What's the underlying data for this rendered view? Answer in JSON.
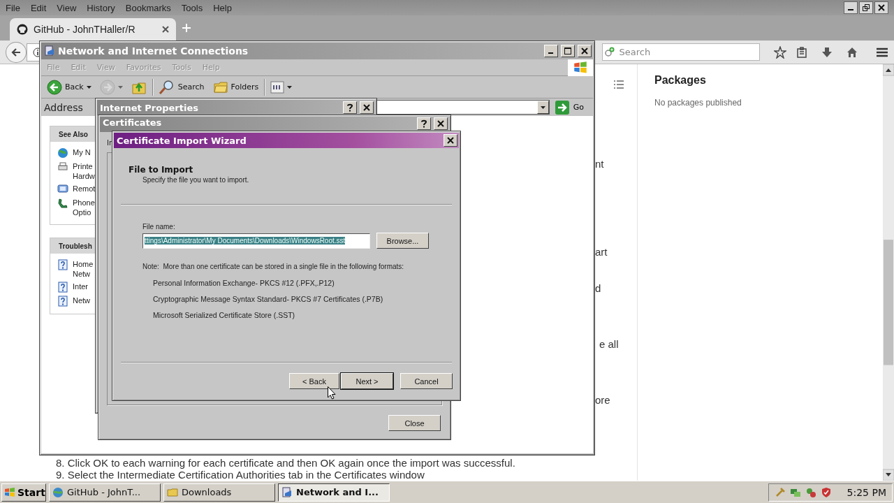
{
  "browser": {
    "menu": [
      "File",
      "Edit",
      "View",
      "History",
      "Bookmarks",
      "Tools",
      "Help"
    ],
    "tabs": [
      {
        "title": "GitHub - JohnTHaller/R",
        "selected": true
      }
    ],
    "search": {
      "placeholder": "Search"
    }
  },
  "page": {
    "fragments": [
      "nt",
      "art",
      "d",
      "e all",
      "ore"
    ],
    "steps": [
      "8. Click OK to each warning for each certificate and then OK again once the import was successful.",
      "9. Select the Intermediate Certification Authorities tab in the Certificates window"
    ],
    "sidebar": {
      "heading": "Packages",
      "text": "No packages published"
    }
  },
  "explorer": {
    "title": "Network and Internet Connections",
    "active": false,
    "menu": [
      {
        "label": "File",
        "disabled": true
      },
      {
        "label": "Edit",
        "disabled": true
      },
      {
        "label": "View",
        "disabled": true
      },
      {
        "label": "Favorites",
        "disabled": true
      },
      {
        "label": "Tools",
        "disabled": true
      },
      {
        "label": "Help",
        "disabled": true
      }
    ],
    "toolbar": [
      {
        "kind": "back",
        "label": "Back",
        "disabled": false
      },
      {
        "kind": "forward",
        "disabled": true
      },
      {
        "kind": "up",
        "disabled": false
      },
      {
        "kind": "search",
        "label": "Search",
        "disabled": false
      },
      {
        "kind": "folders",
        "label": "Folders",
        "disabled": false
      },
      {
        "kind": "views",
        "disabled": false
      }
    ],
    "address": {
      "label": "Address",
      "go": "Go"
    },
    "panes": [
      {
        "title": "See Also",
        "items": [
          {
            "kind": "network",
            "text": "My N"
          },
          {
            "kind": "printer",
            "text": "Printe\nHardw"
          },
          {
            "kind": "remote",
            "text": "Remot"
          },
          {
            "kind": "phone",
            "text": "Phone\nOptio"
          }
        ]
      },
      {
        "title": "Troublesh",
        "items": [
          {
            "kind": "help",
            "text": "Home\nNetw"
          },
          {
            "kind": "help",
            "text": "Inter"
          },
          {
            "kind": "help",
            "text": "Netw"
          }
        ]
      }
    ]
  },
  "internet_properties": {
    "title": "Internet Properties",
    "active": false
  },
  "certificates": {
    "title": "Certificates",
    "active": false,
    "label_fragment": "Ir",
    "close": "Close"
  },
  "wizard": {
    "title": "Certificate Import Wizard",
    "active": true,
    "heading": "File to Import",
    "subheading": "Specify the file you want to import.",
    "file_label": "File name:",
    "file_value": "ttings\\Administrator\\My Documents\\Downloads\\WindowsRoot.sst",
    "file_value_selected": true,
    "browse": "Browse...",
    "note": "Note:  More than one certificate can be stored in a single file in the following formats:",
    "formats": [
      "Personal Information Exchange- PKCS #12 (.PFX,.P12)",
      "Cryptographic Message Syntax Standard- PKCS #7 Certificates (.P7B)",
      "Microsoft Serialized Certificate Store (.SST)"
    ],
    "buttons": [
      {
        "label": "< Back",
        "default": false
      },
      {
        "label": "Next >",
        "default": true
      },
      {
        "label": "Cancel",
        "default": false
      }
    ]
  },
  "taskbar": {
    "start": "Start",
    "tasks": [
      {
        "label": "GitHub - JohnT...",
        "kind": "browser",
        "selected": false
      },
      {
        "label": "Downloads",
        "kind": "folder",
        "selected": false
      },
      {
        "label": "Network and I...",
        "kind": "network",
        "selected": true
      }
    ],
    "clock": "5:25 PM"
  }
}
